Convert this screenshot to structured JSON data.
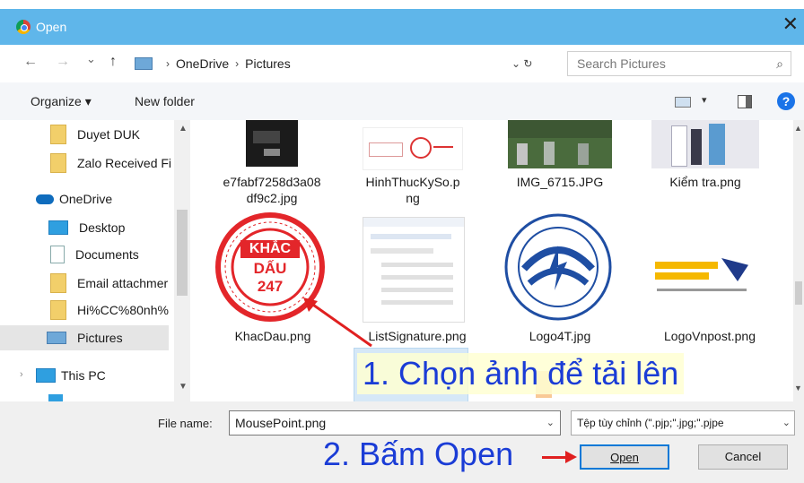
{
  "window": {
    "title": "Open",
    "close_glyph": "✕"
  },
  "nav": {
    "back": "←",
    "forward": "→",
    "recent": "⌄",
    "up": "↑",
    "path": [
      "OneDrive",
      "Pictures"
    ],
    "path_separator": "›",
    "refresh": "⌄ ↻",
    "search_placeholder": "Search Pictures",
    "search_icon": "⌕"
  },
  "toolbar": {
    "organize": "Organize ▾",
    "new_folder": "New folder",
    "help": "?"
  },
  "sidebar": {
    "items": [
      {
        "label": "Duyet DUK",
        "type": "folder"
      },
      {
        "label": "Zalo Received Fi",
        "type": "folder"
      },
      {
        "label": "OneDrive",
        "type": "cloud"
      },
      {
        "label": "Desktop",
        "type": "desktop"
      },
      {
        "label": "Documents",
        "type": "documents"
      },
      {
        "label": "Email attachmer",
        "type": "folder"
      },
      {
        "label": "Hi%CC%80nh%",
        "type": "folder"
      },
      {
        "label": "Pictures",
        "type": "pictures",
        "selected": true
      },
      {
        "label": "This PC",
        "type": "pc"
      }
    ]
  },
  "files": {
    "row1": [
      {
        "name": "e7fabf7258d3a08\ndf9c2.jpg"
      },
      {
        "name": "HinhThucKySo.p\nng"
      },
      {
        "name": "IMG_6715.JPG"
      },
      {
        "name": "Kiểm tra.png"
      }
    ],
    "row2": [
      {
        "name": "KhacDau.png",
        "stamp_lines": [
          "KHẮC",
          "DẤU",
          "247"
        ]
      },
      {
        "name": "ListSignature.png"
      },
      {
        "name": "Logo4T.jpg"
      },
      {
        "name": "LogoVnpost.png"
      }
    ]
  },
  "footer": {
    "file_name_label": "File name:",
    "file_name_value": "MousePoint.png",
    "file_type": "Tệp tùy chỉnh (\".pjp;\".jpg;\".pjpe",
    "open": "Open",
    "cancel": "Cancel",
    "dropdown_arrow": "⌄"
  },
  "annotations": {
    "step1": "1. Chọn ảnh để tải lên",
    "step2": "2. Bấm Open"
  },
  "colors": {
    "titlebar": "#5fb6ea",
    "annotation_blue": "#1a3cd6",
    "arrow_red": "#e02020",
    "focus_blue": "#0078d7"
  }
}
